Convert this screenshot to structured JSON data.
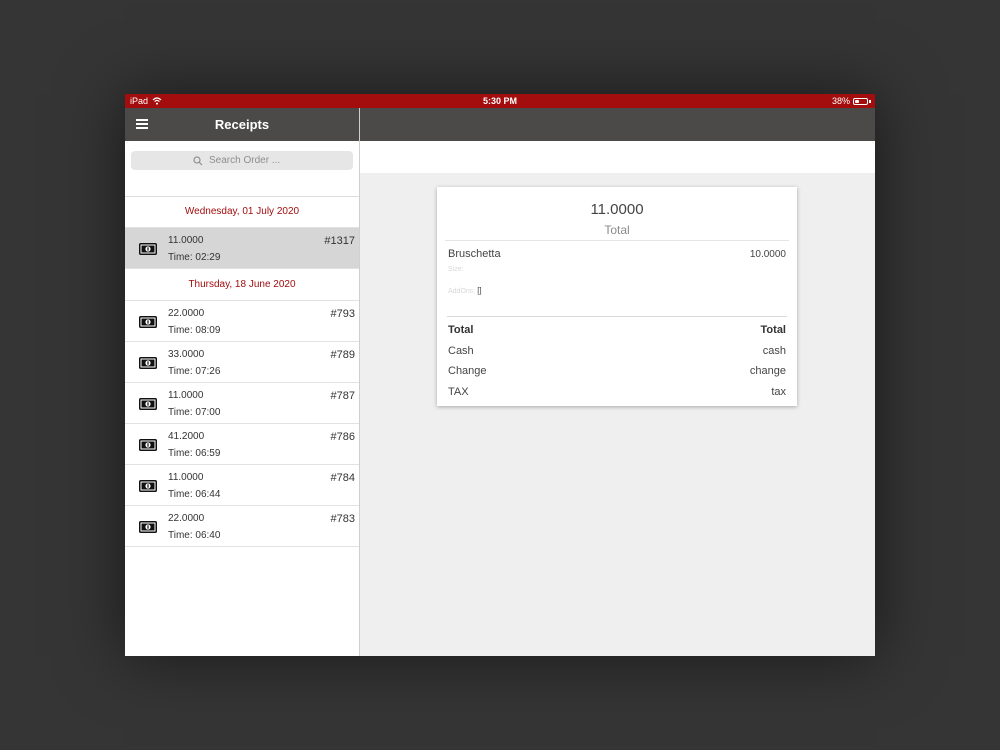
{
  "status_bar": {
    "device": "iPad",
    "time": "5:30 PM",
    "battery": "38%",
    "battery_level": 0.38
  },
  "sidebar": {
    "title": "Receipts",
    "search_placeholder": "Search Order ...",
    "groups": [
      {
        "date": "Wednesday, 01 July 2020",
        "receipts": [
          {
            "amount": "11.0000",
            "time": "Time: 02:29",
            "number": "#1317",
            "selected": true
          }
        ]
      },
      {
        "date": "Thursday, 18 June 2020",
        "receipts": [
          {
            "amount": "22.0000",
            "time": "Time: 08:09",
            "number": "#793"
          },
          {
            "amount": "33.0000",
            "time": "Time: 07:26",
            "number": "#789"
          },
          {
            "amount": "11.0000",
            "time": "Time: 07:00",
            "number": "#787"
          },
          {
            "amount": "41.2000",
            "time": "Time: 06:59",
            "number": "#786"
          },
          {
            "amount": "11.0000",
            "time": "Time: 06:44",
            "number": "#784"
          },
          {
            "amount": "22.0000",
            "time": "Time: 06:40",
            "number": "#783"
          }
        ]
      }
    ]
  },
  "receipt": {
    "total_value": "11.0000",
    "total_label": "Total",
    "item": {
      "name": "Bruschetta",
      "price": "10.0000",
      "size_label": "Size:",
      "addons_label": "AddOns:",
      "addons_value": "[]"
    },
    "summary": {
      "total_label": "Total",
      "total_value": "Total",
      "cash_label": "Cash",
      "cash_value": "cash",
      "change_label": "Change",
      "change_value": "change",
      "tax_label": "TAX",
      "tax_value": "tax"
    }
  },
  "colors": {
    "accent": "#a30d0d",
    "nav_bar": "#4b4a48",
    "selected_row": "#d6d6d6",
    "backdrop": "#353535"
  },
  "icons": {
    "menu": "hamburger-icon",
    "search": "search-icon",
    "receipt": "money-bill-icon",
    "wifi": "wifi-icon",
    "battery": "battery-icon"
  }
}
